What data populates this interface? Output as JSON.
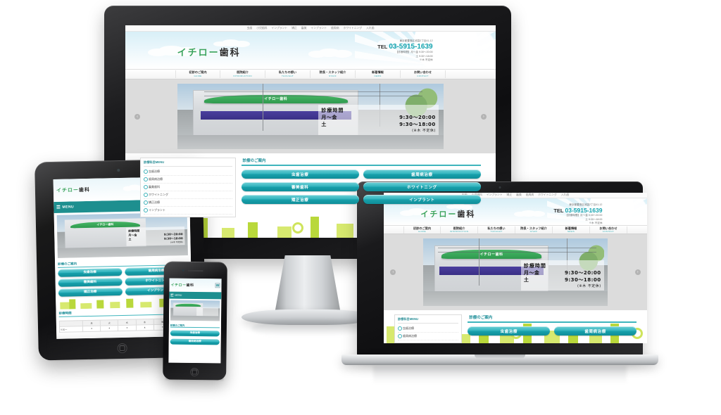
{
  "site": {
    "brand": {
      "kana": "イチロー",
      "kanji": "歯科"
    },
    "utility_nav": [
      "虫歯",
      "小児歯科",
      "インプラント",
      "矯正",
      "審美",
      "インプラント",
      "歯周病",
      "ホワイトニング",
      "入れ歯"
    ],
    "header": {
      "address_line": "東京都豊島区池袋2丁目41-12",
      "tel_word": "TEL",
      "tel_number": "03-5915-1639",
      "hours_line1": "【診療時間】月～金 9:30～20:00",
      "hours_line2": "土 9:30～18:00",
      "hours_line3": "※木 不定休"
    },
    "main_nav": [
      {
        "jp": "初診のご案内",
        "en": "GUIDE"
      },
      {
        "jp": "医院紹介",
        "en": "INTRODUCTION"
      },
      {
        "jp": "私たちの想い",
        "en": "THOUGHT"
      },
      {
        "jp": "院長・スタッフ紹介",
        "en": "STAFF"
      },
      {
        "jp": "新着情報",
        "en": "NEWS"
      },
      {
        "jp": "お問い合わせ",
        "en": "CONTACT"
      }
    ],
    "hero": {
      "storefront_sign": "イチロー歯科",
      "hours_title": "診療時間",
      "row1_days": "月～金",
      "row1_time": "9:30～20:00",
      "row2_days": "土",
      "row2_time": "9:30～18:00",
      "note": "(※木  不定休)",
      "prev_arrow": "‹",
      "next_arrow": "›"
    },
    "sidebar": {
      "title": "診療科目MENU",
      "items": [
        "虫歯治療",
        "歯周病治療",
        "審美歯科",
        "ホワイトニング",
        "矯正治療",
        "インプラント"
      ]
    },
    "section": {
      "title": "診療のご案内",
      "buttons": [
        "虫歯治療",
        "歯周病治療",
        "審美歯科",
        "ホワイトニング",
        "矯正治療",
        "インプラント"
      ]
    },
    "schedule": {
      "title": "診療時間",
      "columns": [
        "",
        "月",
        "火",
        "水",
        "木",
        "金",
        "土"
      ],
      "rows": [
        {
          "label": "9:30～",
          "cells": [
            "●",
            "●",
            "●",
            "▲",
            "●",
            "●"
          ]
        }
      ]
    },
    "mobile": {
      "menu_label": "MENU",
      "tel_icon": "☎"
    }
  },
  "devices": [
    {
      "name": "desktop-imac"
    },
    {
      "name": "tablet-ipad"
    },
    {
      "name": "phone-iphone"
    },
    {
      "name": "laptop-macbook"
    }
  ],
  "colors": {
    "brand_green": "#3aa35c",
    "brand_teal": "#18a0ab",
    "teal_dark": "#1d8f8f",
    "accent_lime": "#b9d83b",
    "tel_teal": "#13a3ae"
  }
}
